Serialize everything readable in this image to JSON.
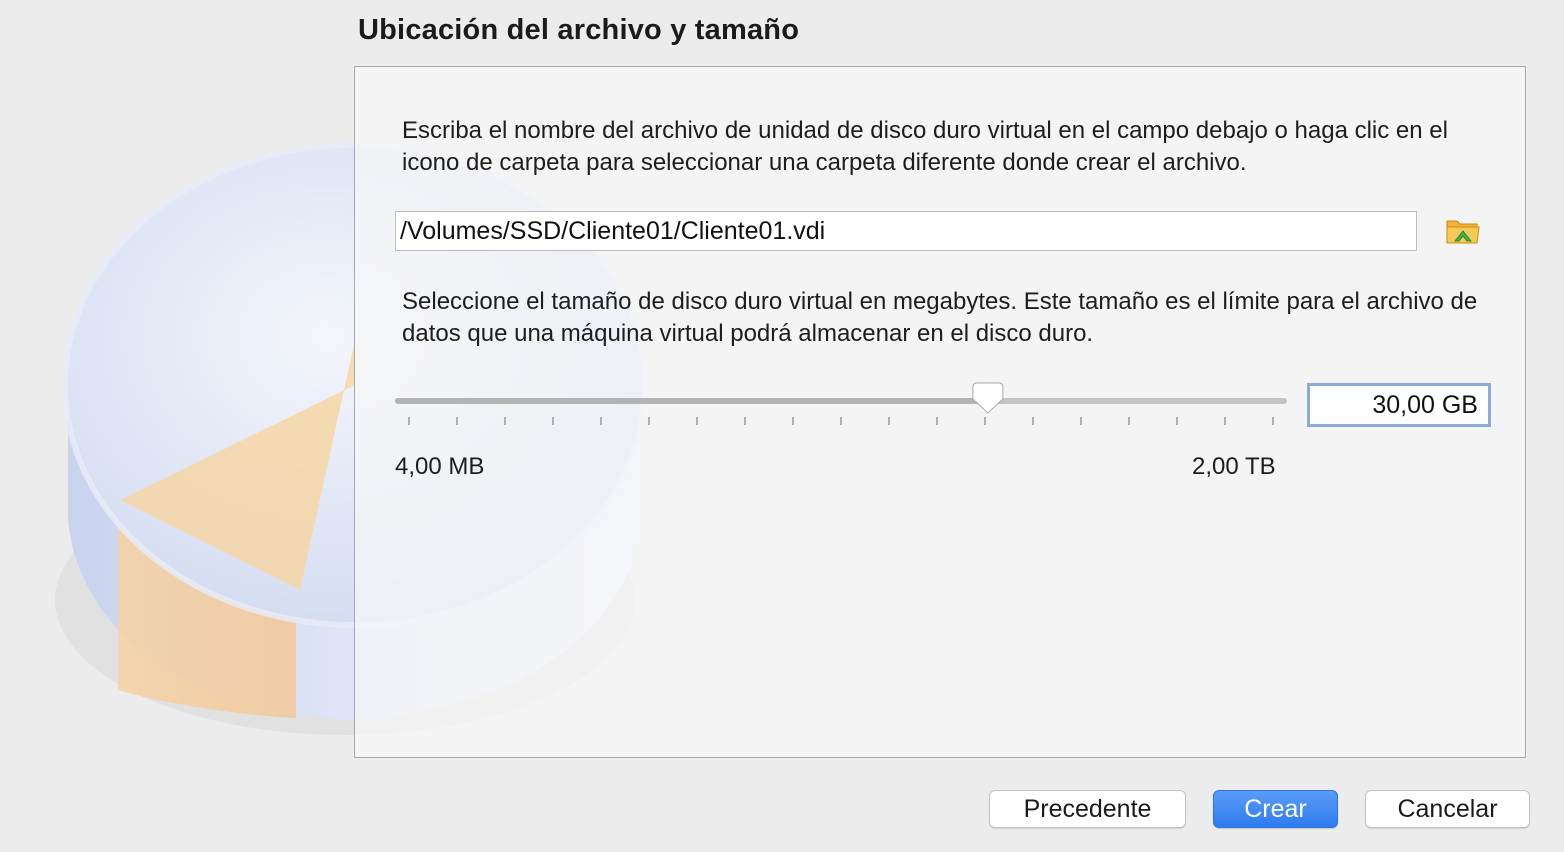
{
  "header": {
    "title": "Ubicación del archivo y tamaño"
  },
  "location": {
    "description": "Escriba el nombre del archivo de unidad de disco duro virtual en el campo debajo o haga clic en el icono de carpeta para seleccionar una carpeta diferente donde crear el archivo.",
    "path_value": "/Volumes/SSD/Cliente01/Cliente01.vdi",
    "folder_icon": "folder-select-icon"
  },
  "size": {
    "description": "Seleccione el tamaño de disco duro virtual en megabytes. Este tamaño es el límite para el archivo de datos que una máquina virtual podrá almacenar en el disco duro.",
    "value_text": "30,00 GB",
    "min_label": "4,00 MB",
    "max_label": "2,00 TB",
    "slider_fraction": 0.67
  },
  "buttons": {
    "back": "Precedente",
    "create": "Crear",
    "cancel": "Cancelar"
  },
  "colors": {
    "primary_button": "#3b86f3",
    "focus_ring": "#8cabd9",
    "disk_accent": "#f7d9a6"
  }
}
